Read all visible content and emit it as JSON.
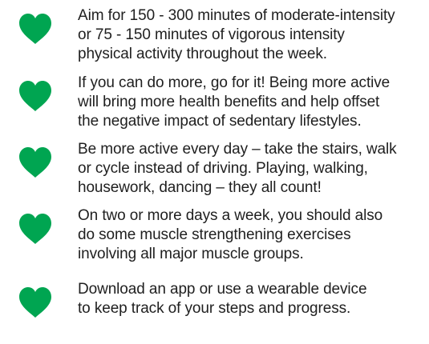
{
  "icon": {
    "name": "heart-icon",
    "color": "#00a551"
  },
  "tips": [
    {
      "text": "Aim for 150 - 300 minutes of moderate-intensity\nor 75 - 150 minutes of vigorous intensity\nphysical activity throughout the week."
    },
    {
      "text": "If you can do more, go for it! Being more active\nwill bring more health benefits and help offset\nthe negative impact of sedentary lifestyles."
    },
    {
      "text": "Be more active every day – take the stairs, walk\nor cycle instead of driving. Playing, walking,\nhousework, dancing – they all count!"
    },
    {
      "text": "On two or more days a week, you should also\ndo some muscle strengthening exercises\ninvolving all major muscle groups."
    },
    {
      "text": "Download an app or use a wearable device\nto keep track of your steps and progress."
    }
  ]
}
